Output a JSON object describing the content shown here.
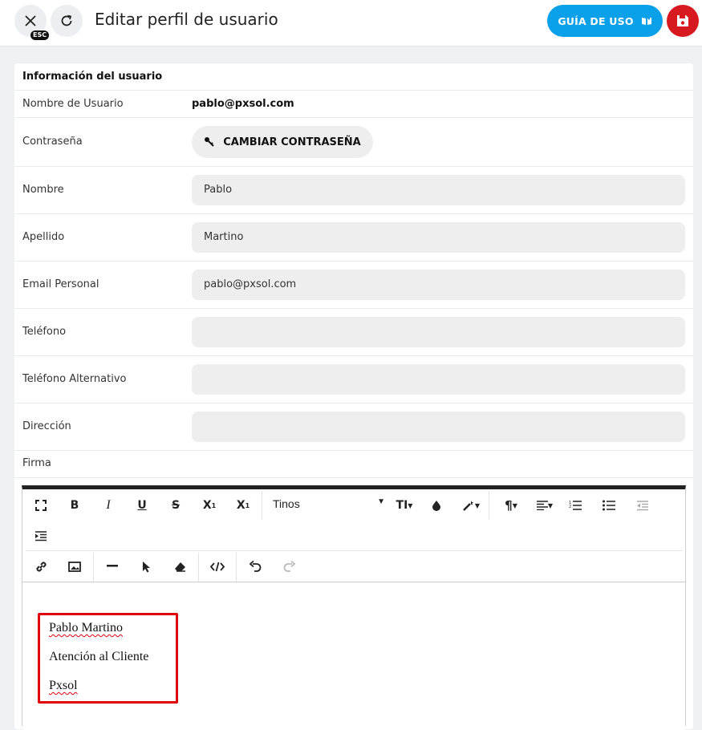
{
  "header": {
    "esc_badge": "ESC",
    "title": "Editar perfil de usuario",
    "guide_label": "GUÍA DE USO"
  },
  "section_title": "Información del usuario",
  "fields": {
    "username_label": "Nombre de Usuario",
    "username_value": "pablo@pxsol.com",
    "password_label": "Contraseña",
    "password_button": "CAMBIAR CONTRASEÑA",
    "first_name_label": "Nombre",
    "first_name_value": "Pablo",
    "last_name_label": "Apellido",
    "last_name_value": "Martino",
    "email_label": "Email Personal",
    "email_value": "pablo@pxsol.com",
    "phone_label": "Teléfono",
    "phone_value": "",
    "alt_phone_label": "Teléfono Alternativo",
    "alt_phone_value": "",
    "address_label": "Dirección",
    "address_value": "",
    "signature_label": "Firma"
  },
  "editor": {
    "font_name": "Tinos",
    "signature_lines": [
      "Pablo Martino",
      "Atención al Cliente",
      "Pxsol"
    ]
  }
}
